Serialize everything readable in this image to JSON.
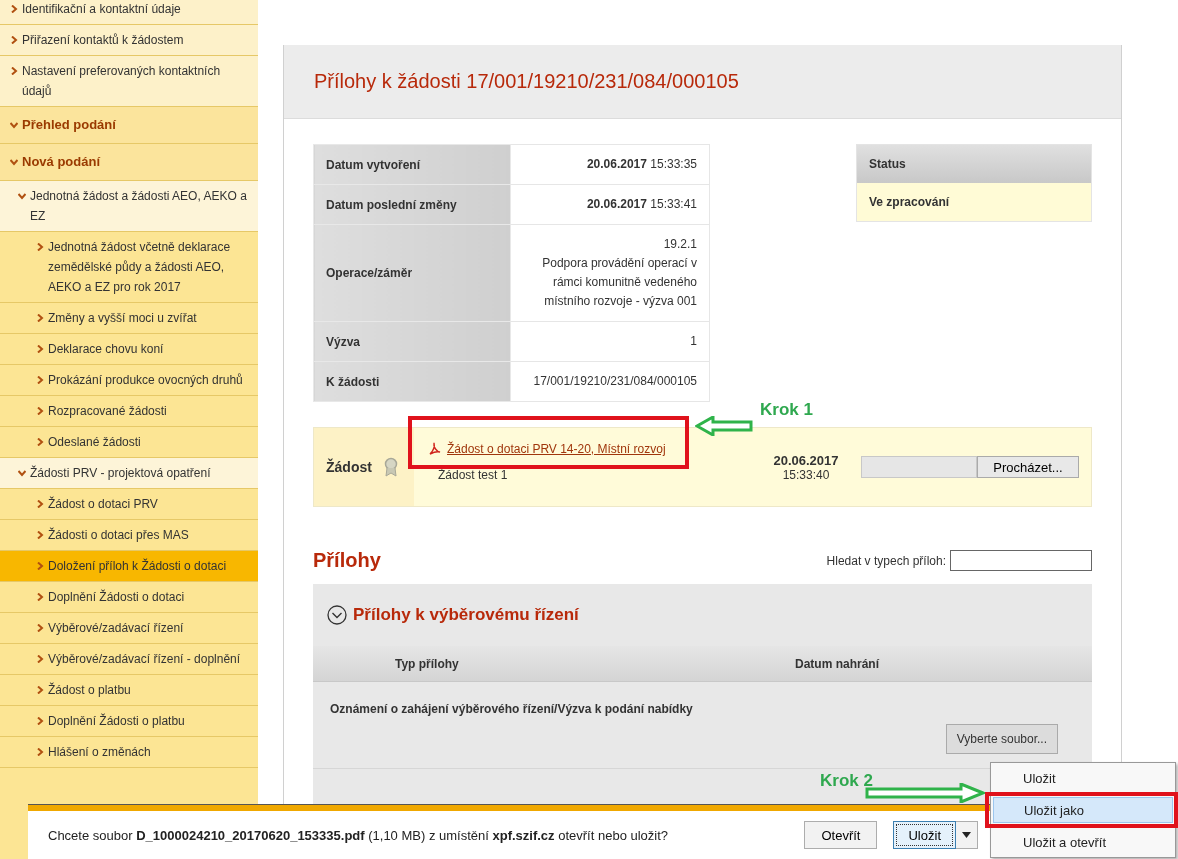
{
  "sidebar": {
    "items": [
      {
        "label": "Identifikační a kontaktní údaje",
        "kind": "link",
        "selected": false
      },
      {
        "label": "Přiřazení kontaktů k žádostem",
        "kind": "link",
        "selected": false
      },
      {
        "label": "Nastavení preferovaných kontaktních údajů",
        "kind": "link",
        "selected": false
      },
      {
        "label": "Přehled podání",
        "kind": "section",
        "expanded": true,
        "selected": false
      },
      {
        "label": "Nová podání",
        "kind": "section",
        "expanded": true,
        "selected": false,
        "children": [
          {
            "label": "Jednotná žádost a žádosti AEO, AEKO a EZ",
            "kind": "group",
            "expanded": true,
            "selected": false,
            "children": [
              {
                "label": "Jednotná žádost včetně deklarace zemědělské půdy a žádosti AEO, AEKO a EZ pro rok 2017",
                "kind": "leaf",
                "selected": false
              },
              {
                "label": "Změny a vyšší moci u zvířat",
                "kind": "leaf",
                "selected": false
              },
              {
                "label": "Deklarace chovu koní",
                "kind": "leaf",
                "selected": false
              },
              {
                "label": "Prokázání produkce ovocných druhů",
                "kind": "leaf",
                "selected": false
              },
              {
                "label": "Rozpracované žádosti",
                "kind": "leaf",
                "selected": false
              },
              {
                "label": "Odeslané žádosti",
                "kind": "leaf",
                "selected": false
              }
            ]
          },
          {
            "label": "Žádosti PRV - projektová opatření",
            "kind": "group",
            "expanded": true,
            "selected": false,
            "children": [
              {
                "label": "Žádost o dotaci PRV",
                "kind": "leaf",
                "selected": false
              },
              {
                "label": "Žádosti o dotaci přes MAS",
                "kind": "leaf",
                "selected": false
              },
              {
                "label": "Doložení příloh k Žádosti o dotaci",
                "kind": "leaf",
                "selected": true
              },
              {
                "label": "Doplnění Žádosti o dotaci",
                "kind": "leaf",
                "selected": false
              },
              {
                "label": "Výběrové/zadávací řízení",
                "kind": "leaf",
                "selected": false
              },
              {
                "label": "Výběrové/zadávací řízení - doplnění",
                "kind": "leaf",
                "selected": false
              },
              {
                "label": "Žádost o platbu",
                "kind": "leaf",
                "selected": false
              },
              {
                "label": "Doplnění Žádosti o platbu",
                "kind": "leaf",
                "selected": false
              },
              {
                "label": "Hlášení o změnách",
                "kind": "leaf",
                "selected": false
              }
            ]
          }
        ]
      }
    ]
  },
  "page": {
    "title": "Přílohy k žádosti 17/001/19210/231/084/000105",
    "info": [
      {
        "label": "Datum vytvoření",
        "value": [
          "**20.06.2017** 15:33:35"
        ]
      },
      {
        "label": "Datum poslední změny",
        "value": [
          "**20.06.2017** 15:33:41"
        ]
      },
      {
        "label": "Operace/záměr",
        "value": [
          "19.2.1",
          "Podpora provádění operací v rámci komunitně vedeného místního rozvoje - výzva 001"
        ]
      },
      {
        "label": "Výzva",
        "value": [
          "1"
        ]
      },
      {
        "label": "K žádosti",
        "value": [
          "17/001/19210/231/084/000105"
        ]
      }
    ],
    "status": {
      "heading": "Status",
      "value": "Ve zpracování"
    },
    "application": {
      "label": "Žádost",
      "link": "Žádost o dotaci PRV 14-20, Místní rozvoj",
      "note": "Žádost test 1",
      "date": "20.06.2017",
      "time": "15:33:40",
      "browse_button": "Procházet..."
    },
    "attachments": {
      "heading": "Přílohy",
      "search_label": "Hledat v typech příloh:",
      "section": {
        "title": "Přílohy k výběrovému řízení",
        "expanded": true,
        "columns": [
          "Typ přílohy",
          "Datum nahrání"
        ],
        "rows": [
          {
            "type": "Oznámení o zahájení výběrového řízení/Výzva k podání nabídky",
            "button": "Vyberte soubor..."
          }
        ]
      }
    }
  },
  "annotations": [
    {
      "label": "Krok 1"
    },
    {
      "label": "Krok 2"
    }
  ],
  "download_bar": {
    "message": "Chcete soubor **D_1000024210_20170620_153335.pdf** (1,10 MB) z umístění **xpf.szif.cz** otevřít nebo uložit?",
    "open_button": "Otevřít",
    "save_button": "Uložit",
    "menu": [
      {
        "label": "Uložit",
        "selected": false
      },
      {
        "label": "Uložit jako",
        "selected": true
      },
      {
        "label": "Uložit a otevřít",
        "selected": false
      }
    ]
  }
}
